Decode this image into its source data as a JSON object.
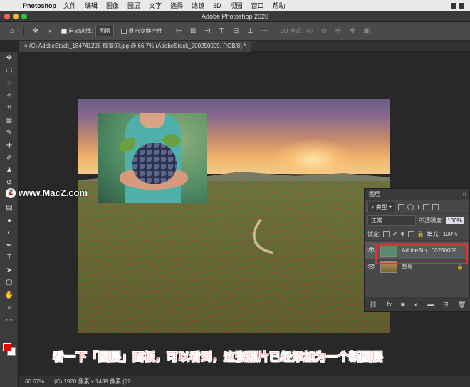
{
  "menubar": {
    "app": "Photoshop",
    "items": [
      "文件",
      "编辑",
      "图像",
      "图层",
      "文字",
      "选择",
      "滤镜",
      "3D",
      "视图",
      "窗口",
      "帮助"
    ]
  },
  "window": {
    "title": "Adobe Photoshop 2020"
  },
  "options": {
    "auto_select_label": "自动选择:",
    "auto_select_value": "图层",
    "show_transform_label": "显示变换控件",
    "mode_3d": "3D 模式:"
  },
  "tab": {
    "label": "(C) AdobeStock_184741298-恢复的.jpg @ 66.7% (AdobeStock_200250009, RGB/8) *"
  },
  "tools": [
    "move-tool",
    "marquee-tool",
    "lasso-tool",
    "magic-wand-tool",
    "crop-tool",
    "frame-tool",
    "eyedropper-tool",
    "healing-tool",
    "brush-tool",
    "stamp-tool",
    "history-brush-tool",
    "eraser-tool",
    "gradient-tool",
    "blur-tool",
    "dodge-tool",
    "pen-tool",
    "type-tool",
    "path-select-tool",
    "rectangle-tool",
    "hand-tool",
    "zoom-tool"
  ],
  "colors": {
    "foreground": "#e00000",
    "background": "#ffffff",
    "highlight": "#e03030"
  },
  "watermark": {
    "text": "www.MacZ.com"
  },
  "caption": {
    "text": "看一下「图层」面板，可以看到，这张照片已经添加为一个新图层"
  },
  "status": {
    "zoom": "66.67%",
    "info": "(C) 1920 像素 x 1439 像素 (72..."
  },
  "layers_panel": {
    "title": "图层",
    "filter": "类型",
    "blend_mode": "正常",
    "opacity_label": "不透明度:",
    "opacity_value": "100%",
    "lock_label": "锁定:",
    "fill_label": "填充:",
    "fill_value": "100%",
    "layers": [
      {
        "name": "AdobeSto...00250009",
        "selected": true
      },
      {
        "name": "背景",
        "selected": false
      }
    ],
    "footer_icons": [
      "link-icon",
      "fx-icon",
      "mask-icon",
      "adjustment-icon",
      "folder-icon",
      "new-layer-icon",
      "trash-icon"
    ]
  }
}
